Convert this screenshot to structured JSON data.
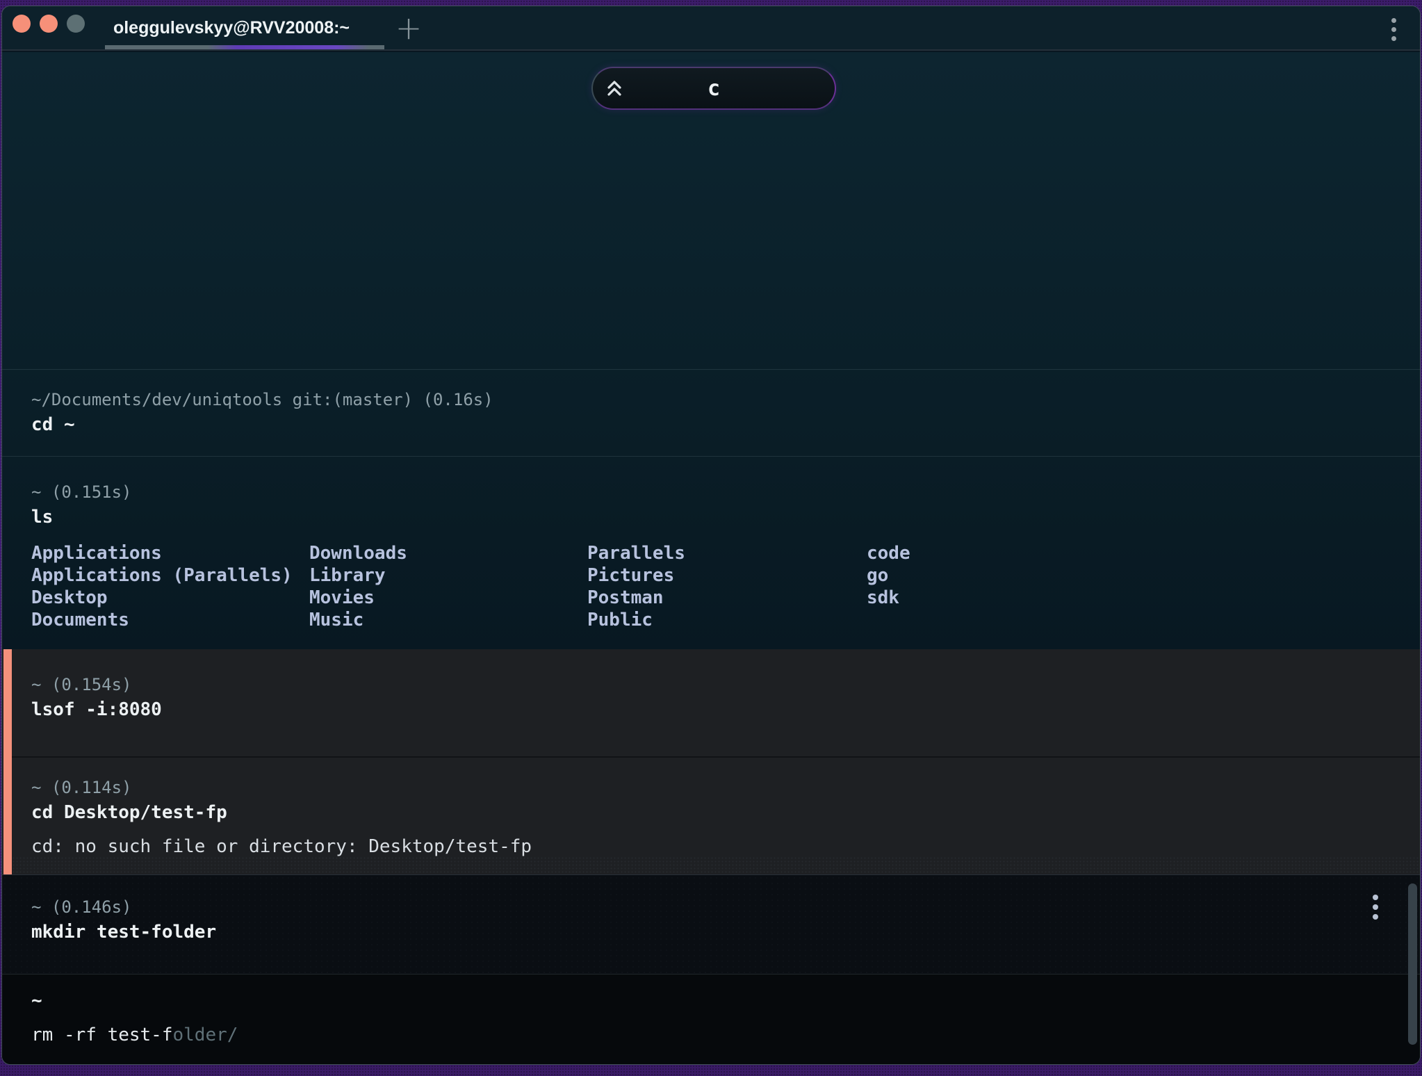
{
  "colors": {
    "accent_orange": "#f4917c",
    "desktop_purple": "#452179",
    "terminal_teal_top": "#0d2530",
    "block_gray": "#1e2023",
    "listing_text": "#b7c2de"
  },
  "tab_bar": {
    "title": "oleggulevskyy@RVV20008:~",
    "new_tab_icon": "+"
  },
  "command_pill": {
    "label": "c"
  },
  "blocks": [
    {
      "header": "~/Documents/dev/uniqtools git:(master) (0.16s)",
      "command": "cd ~"
    },
    {
      "header": "~ (0.151s)",
      "command": "ls",
      "listing": [
        [
          "Applications",
          "Applications (Parallels)",
          "Desktop",
          "Documents"
        ],
        [
          "Downloads",
          "Library",
          "Movies",
          "Music"
        ],
        [
          "Parallels",
          "Pictures",
          "Postman",
          "Public"
        ],
        [
          "code",
          "go",
          "sdk"
        ]
      ]
    },
    {
      "header": "~ (0.154s)",
      "command": "lsof -i:8080"
    },
    {
      "header": "~ (0.114s)",
      "command": "cd Desktop/test-fp",
      "output": "cd: no such file or directory: Desktop/test-fp"
    },
    {
      "header": "~ (0.146s)",
      "command": "mkdir test-folder"
    }
  ],
  "prompt_block": {
    "prompt": "~",
    "typed": "rm -rf test-f",
    "suggestion": "older/"
  }
}
